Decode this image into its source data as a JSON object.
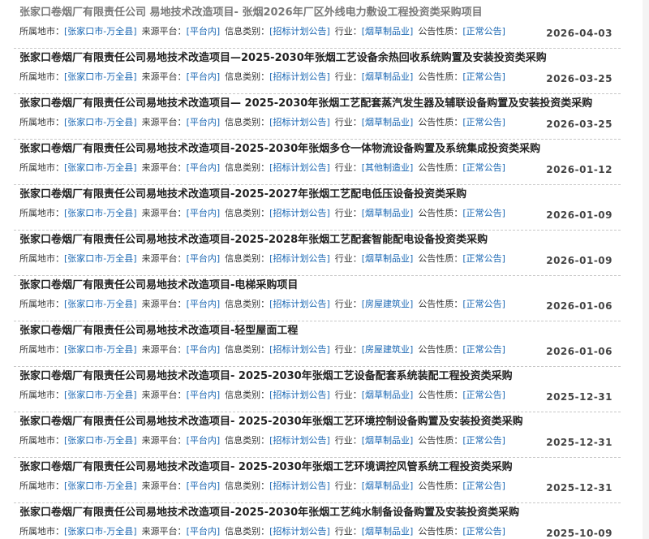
{
  "labels": {
    "region": "所属地市：",
    "platform": "来源平台：",
    "info_type": "信息类别：",
    "industry": "行业：",
    "nature": "公告性质："
  },
  "items": [
    {
      "title": "张家口卷烟厂有限责任公司 易地技术改造项目- 张烟2026年厂区外线电力敷设工程投资类采购项目",
      "region": "[张家口市-万全县]",
      "platform": "[平台内]",
      "info_type": "[招标计划公告]",
      "industry": "[烟草制品业]",
      "nature": "[正常公告]",
      "date": "2026-04-03"
    },
    {
      "title": "张家口卷烟厂有限责任公司易地技术改造项目—2025-2030年张烟工艺设备余热回收系统购置及安装投资类采购",
      "region": "[张家口市-万全县]",
      "platform": "[平台内]",
      "info_type": "[招标计划公告]",
      "industry": "[烟草制品业]",
      "nature": "[正常公告]",
      "date": "2026-03-25"
    },
    {
      "title": "张家口卷烟厂有限责任公司易地技术改造项目— 2025-2030年张烟工艺配套蒸汽发生器及辅联设备购置及安装投资类采购",
      "region": "[张家口市-万全县]",
      "platform": "[平台内]",
      "info_type": "[招标计划公告]",
      "industry": "[烟草制品业]",
      "nature": "[正常公告]",
      "date": "2026-03-25"
    },
    {
      "title": "张家口卷烟厂有限责任公司易地技术改造项目-2025-2030年张烟多仓一体物流设备购置及系统集成投资类采购",
      "region": "[张家口市-万全县]",
      "platform": "[平台内]",
      "info_type": "[招标计划公告]",
      "industry": "[其他制造业]",
      "nature": "[正常公告]",
      "date": "2026-01-12"
    },
    {
      "title": "张家口卷烟厂有限责任公司易地技术改造项目-2025-2027年张烟工艺配电低压设备投资类采购",
      "region": "[张家口市-万全县]",
      "platform": "[平台内]",
      "info_type": "[招标计划公告]",
      "industry": "[烟草制品业]",
      "nature": "[正常公告]",
      "date": "2026-01-09"
    },
    {
      "title": "张家口卷烟厂有限责任公司易地技术改造项目-2025-2028年张烟工艺配套智能配电设备投资类采购",
      "region": "[张家口市-万全县]",
      "platform": "[平台内]",
      "info_type": "[招标计划公告]",
      "industry": "[烟草制品业]",
      "nature": "[正常公告]",
      "date": "2026-01-09"
    },
    {
      "title": "张家口卷烟厂有限责任公司易地技术改造项目-电梯采购项目",
      "region": "[张家口市-万全县]",
      "platform": "[平台内]",
      "info_type": "[招标计划公告]",
      "industry": "[房屋建筑业]",
      "nature": "[正常公告]",
      "date": "2026-01-06"
    },
    {
      "title": "张家口卷烟厂有限责任公司易地技术改造项目-轻型屋面工程",
      "region": "[张家口市-万全县]",
      "platform": "[平台内]",
      "info_type": "[招标计划公告]",
      "industry": "[房屋建筑业]",
      "nature": "[正常公告]",
      "date": "2026-01-06"
    },
    {
      "title": "张家口卷烟厂有限责任公司易地技术改造项目- 2025-2030年张烟工艺设备配套系统装配工程投资类采购",
      "region": "[张家口市-万全县]",
      "platform": "[平台内]",
      "info_type": "[招标计划公告]",
      "industry": "[烟草制品业]",
      "nature": "[正常公告]",
      "date": "2025-12-31"
    },
    {
      "title": "张家口卷烟厂有限责任公司易地技术改造项目- 2025-2030年张烟工艺环境控制设备购置及安装投资类采购",
      "region": "[张家口市-万全县]",
      "platform": "[平台内]",
      "info_type": "[招标计划公告]",
      "industry": "[烟草制品业]",
      "nature": "[正常公告]",
      "date": "2025-12-31"
    },
    {
      "title": "张家口卷烟厂有限责任公司易地技术改造项目- 2025-2030年张烟工艺环境调控风管系统工程投资类采购",
      "region": "[张家口市-万全县]",
      "platform": "[平台内]",
      "info_type": "[招标计划公告]",
      "industry": "[烟草制品业]",
      "nature": "[正常公告]",
      "date": "2025-12-31"
    },
    {
      "title": "张家口卷烟厂有限责任公司易地技术改造项目-2025-2030年张烟工艺纯水制备设备购置及安装投资类采购",
      "region": "[张家口市-万全县]",
      "platform": "[平台内]",
      "info_type": "[招标计划公告]",
      "industry": "[烟草制品业]",
      "nature": "[正常公告]",
      "date": "2025-10-09"
    }
  ]
}
